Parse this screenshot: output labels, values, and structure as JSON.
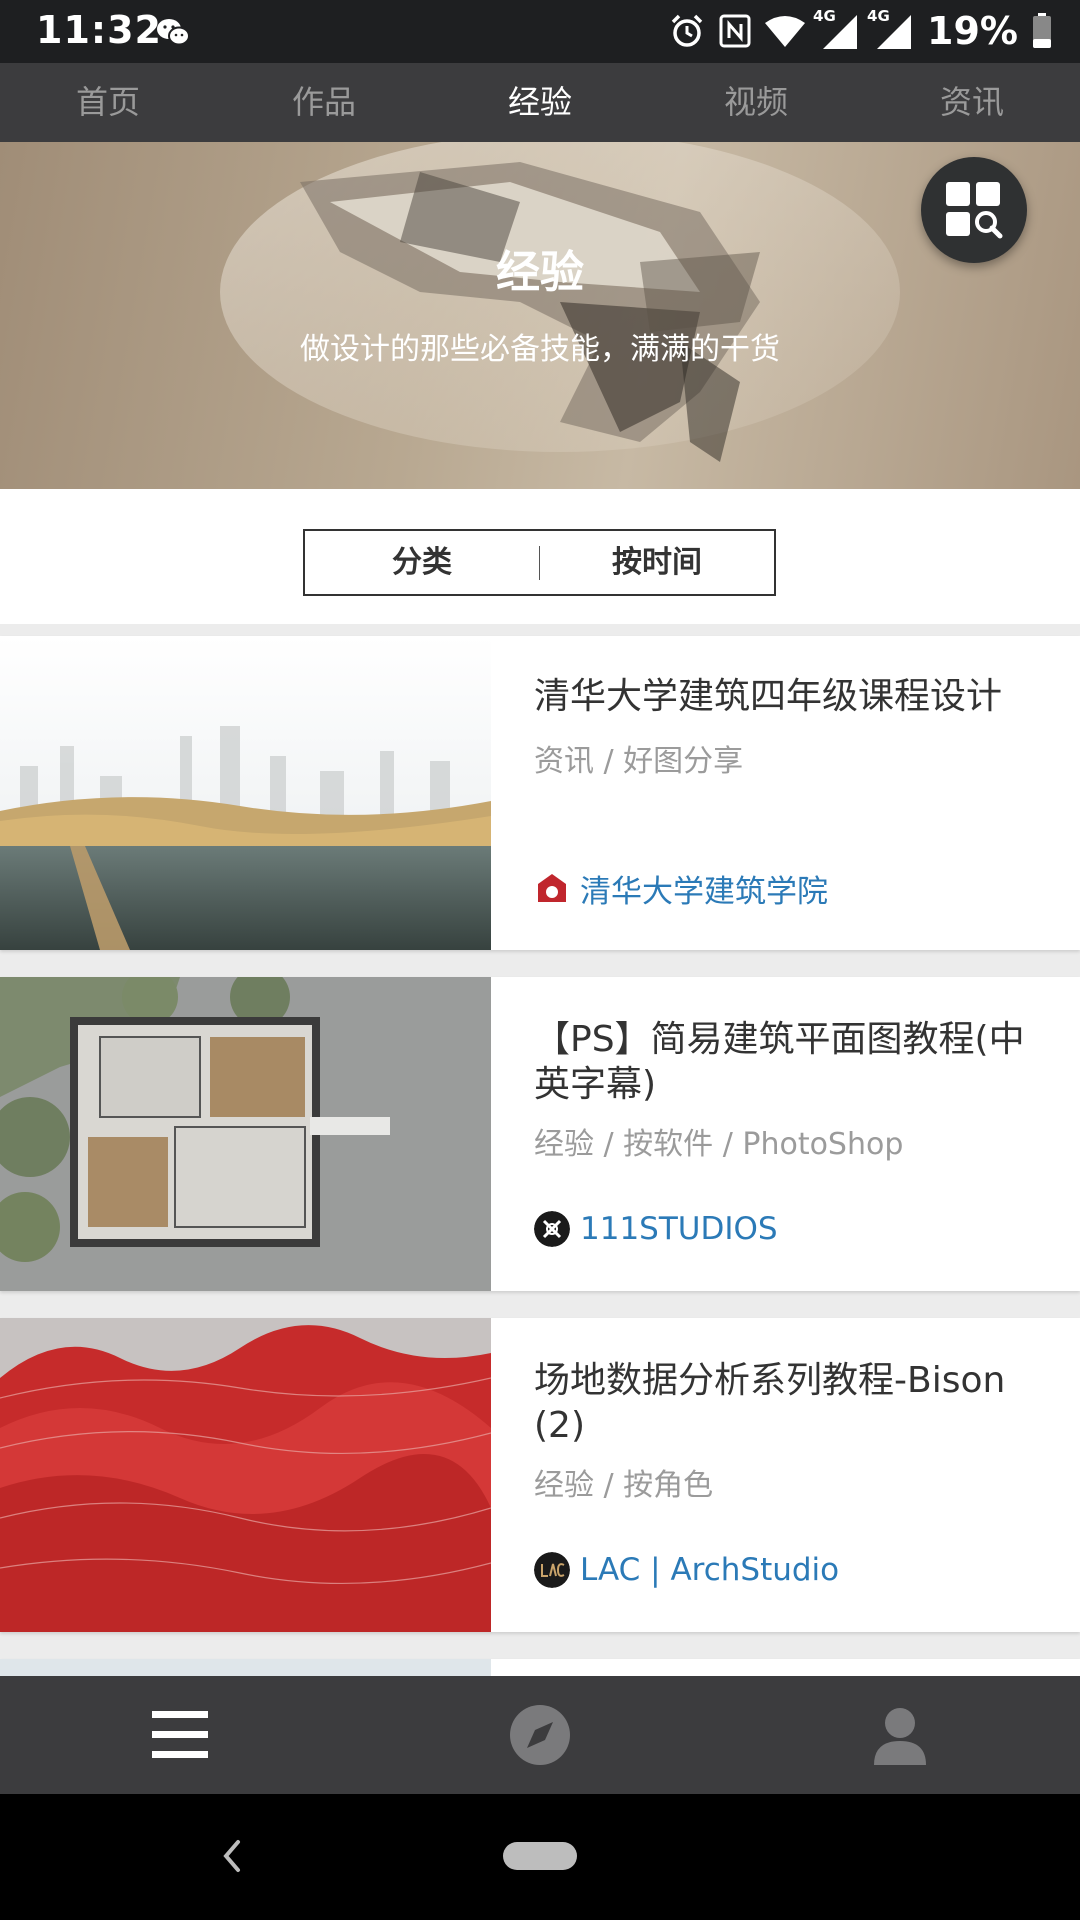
{
  "status_bar": {
    "time": "11:32",
    "network_1": "4G",
    "network_2": "4G",
    "battery": "19%",
    "icons": [
      "wechat-icon",
      "alarm-icon",
      "nfc-icon",
      "wifi-icon",
      "signal-icon",
      "battery-icon"
    ]
  },
  "top_nav": {
    "tabs": [
      {
        "label": "首页"
      },
      {
        "label": "作品"
      },
      {
        "label": "经验",
        "active": true
      },
      {
        "label": "视频"
      },
      {
        "label": "资讯"
      }
    ]
  },
  "hero": {
    "title": "经验",
    "subtitle": "做设计的那些必备技能，满满的干货",
    "button_icon": "grid-search-icon"
  },
  "filter": {
    "category_label": "分类",
    "time_label": "按时间"
  },
  "articles": [
    {
      "title": "清华大学建筑四年级课程设计",
      "meta": "资讯 / 好图分享",
      "author": "清华大学建筑学院",
      "author_icon": "tsinghua-logo-icon",
      "author_color": "#c0262d"
    },
    {
      "title": "【PS】简易建筑平面图教程(中英字幕)",
      "meta": "经验 / 按软件 / PhotoShop",
      "author": "111STUDIOS",
      "author_icon": "studio-logo-icon",
      "author_color": "#1a1a1a"
    },
    {
      "title": "场地数据分析系列教程-Bison (2)",
      "meta": "经验 / 按角色",
      "author": "LAC | ArchStudio",
      "author_icon": "lac-logo-icon",
      "author_color": "#1a1a1a"
    }
  ],
  "bottom_nav": {
    "items": [
      {
        "icon": "menu-icon",
        "active": true
      },
      {
        "icon": "compass-icon",
        "active": false
      },
      {
        "icon": "profile-icon",
        "active": false
      }
    ]
  },
  "system_nav": {
    "icons": [
      "back-icon",
      "home-pill-icon"
    ]
  },
  "colors": {
    "link": "#2b7ab7",
    "bar": "#3c3c3e",
    "status": "#1e1f21"
  }
}
